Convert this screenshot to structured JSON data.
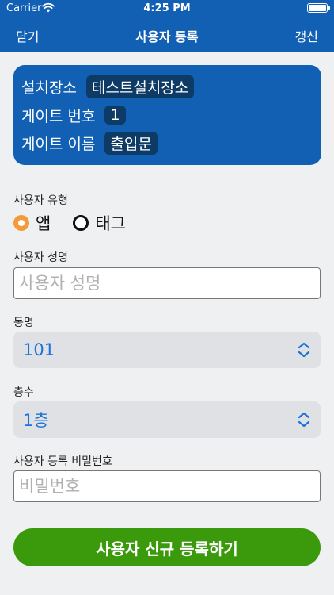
{
  "status": {
    "carrier": "Carrier",
    "time": "4:25 PM"
  },
  "nav": {
    "close": "닫기",
    "title": "사용자 등록",
    "refresh": "갱신"
  },
  "info": {
    "site_label": "설치장소",
    "site_value": "테스트설치장소",
    "gate_no_label": "게이트 번호",
    "gate_no_value": "1",
    "gate_name_label": "게이트 이름",
    "gate_name_value": "출입문"
  },
  "user_type": {
    "label": "사용자 유형",
    "options": [
      "앱",
      "태그"
    ],
    "selected": "앱"
  },
  "name": {
    "label": "사용자 성명",
    "placeholder": "사용자 성명",
    "value": ""
  },
  "building": {
    "label": "동명",
    "value": "101"
  },
  "floor": {
    "label": "층수",
    "value": "1층"
  },
  "password": {
    "label": "사용자 등록 비밀번호",
    "placeholder": "비밀번호",
    "value": ""
  },
  "submit": {
    "label": "사용자 신규 등록하기"
  },
  "colors": {
    "primary": "#1160b3",
    "chip": "#0d3b66",
    "accent": "#f39a3a",
    "submit": "#3a9a0c",
    "select_text": "#1a73d9"
  }
}
